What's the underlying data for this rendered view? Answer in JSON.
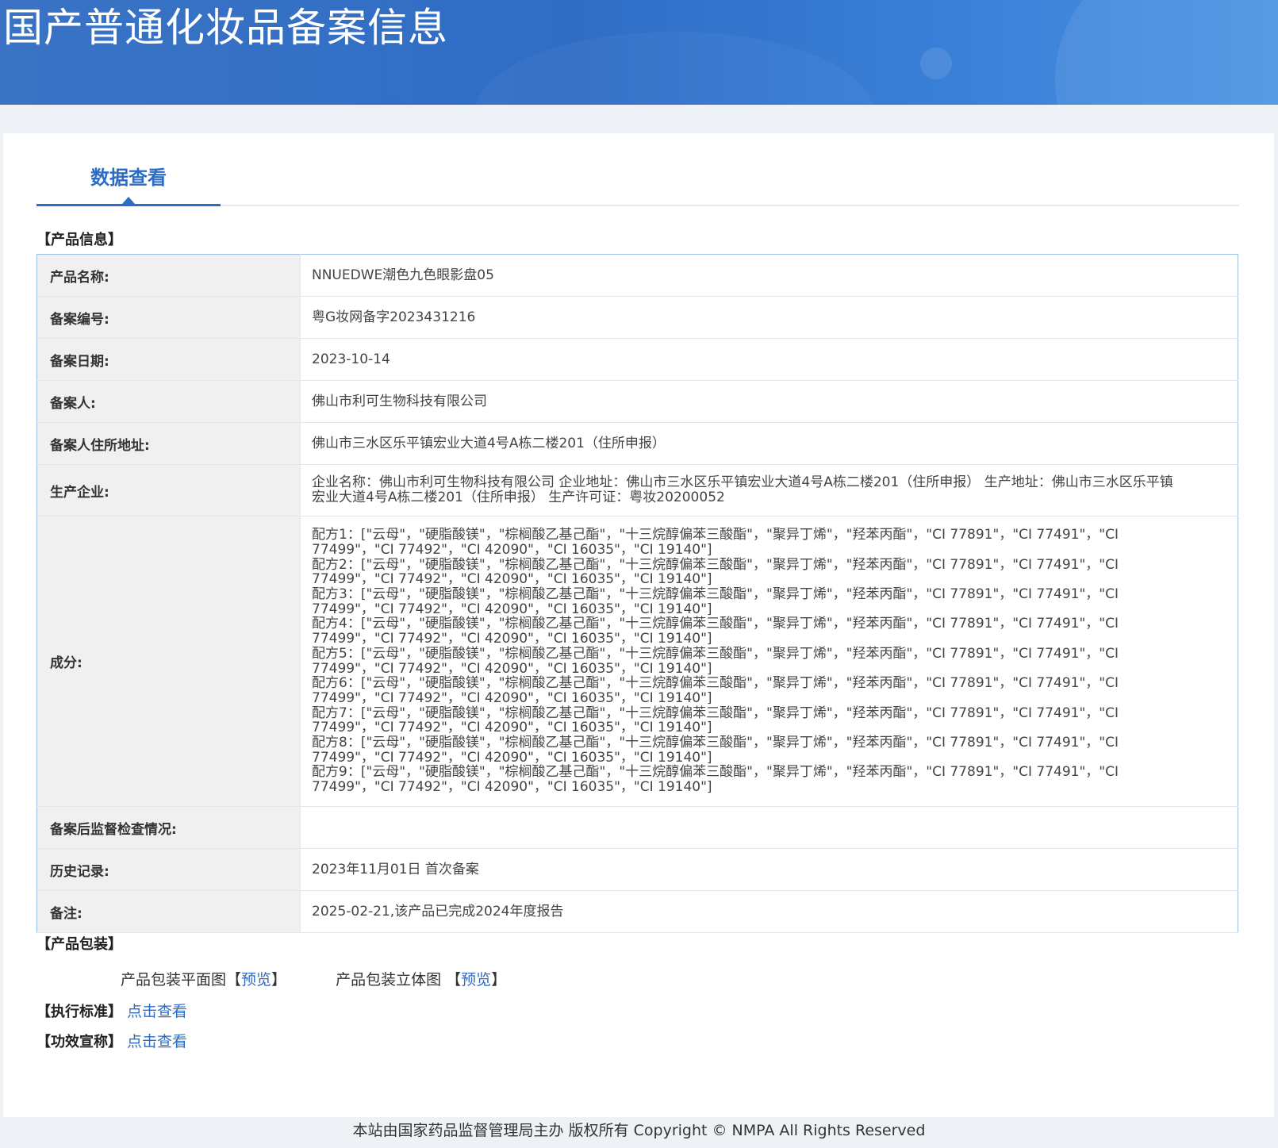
{
  "header": {
    "title": "国产普通化妆品备案信息"
  },
  "tab": {
    "label": "数据查看"
  },
  "sections": {
    "product_info": "【产品信息】",
    "packaging": "【产品包装】"
  },
  "product": {
    "name_label": "产品名称:",
    "name": "NNUEDWE潮色九色眼影盘05",
    "record_no_label": "备案编号:",
    "record_no": "粤G妆网备字2023431216",
    "record_date_label": "备案日期:",
    "record_date": "2023-10-14",
    "registrant_label": "备案人:",
    "registrant": "佛山市利可生物科技有限公司",
    "address_label": "备案人住所地址:",
    "address": "佛山市三水区乐平镇宏业大道4号A栋二楼201（住所申报）",
    "manufacturer_label": "生产企业:",
    "manufacturer": "企业名称：佛山市利可生物科技有限公司 企业地址：佛山市三水区乐平镇宏业大道4号A栋二楼201（住所申报） 生产地址：佛山市三水区乐平镇宏业大道4号A栋二楼201（住所申报） 生产许可证：粤妆20200052",
    "ingredients_label": "成分:",
    "ingredients": [
      "配方1：[\"云母\"，\"硬脂酸镁\"，\"棕榈酸乙基己酯\"，\"十三烷醇偏苯三酸酯\"，\"聚异丁烯\"，\"羟苯丙酯\"，\"CI 77891\"，\"CI 77491\"，\"CI 77499\"，\"CI 77492\"，\"CI 42090\"，\"CI 16035\"，\"CI 19140\"]",
      "配方2：[\"云母\"，\"硬脂酸镁\"，\"棕榈酸乙基己酯\"，\"十三烷醇偏苯三酸酯\"，\"聚异丁烯\"，\"羟苯丙酯\"，\"CI 77891\"，\"CI 77491\"，\"CI 77499\"，\"CI 77492\"，\"CI 42090\"，\"CI 16035\"，\"CI 19140\"]",
      "配方3：[\"云母\"，\"硬脂酸镁\"，\"棕榈酸乙基己酯\"，\"十三烷醇偏苯三酸酯\"，\"聚异丁烯\"，\"羟苯丙酯\"，\"CI 77891\"，\"CI 77491\"，\"CI 77499\"，\"CI 77492\"，\"CI 42090\"，\"CI 16035\"，\"CI 19140\"]",
      "配方4：[\"云母\"，\"硬脂酸镁\"，\"棕榈酸乙基己酯\"，\"十三烷醇偏苯三酸酯\"，\"聚异丁烯\"，\"羟苯丙酯\"，\"CI 77891\"，\"CI 77491\"，\"CI 77499\"，\"CI 77492\"，\"CI 42090\"，\"CI 16035\"，\"CI 19140\"]",
      "配方5：[\"云母\"，\"硬脂酸镁\"，\"棕榈酸乙基己酯\"，\"十三烷醇偏苯三酸酯\"，\"聚异丁烯\"，\"羟苯丙酯\"，\"CI 77891\"，\"CI 77491\"，\"CI 77499\"，\"CI 77492\"，\"CI 42090\"，\"CI 16035\"，\"CI 19140\"]",
      "配方6：[\"云母\"，\"硬脂酸镁\"，\"棕榈酸乙基己酯\"，\"十三烷醇偏苯三酸酯\"，\"聚异丁烯\"，\"羟苯丙酯\"，\"CI 77891\"，\"CI 77491\"，\"CI 77499\"，\"CI 77492\"，\"CI 42090\"，\"CI 16035\"，\"CI 19140\"]",
      "配方7：[\"云母\"，\"硬脂酸镁\"，\"棕榈酸乙基己酯\"，\"十三烷醇偏苯三酸酯\"，\"聚异丁烯\"，\"羟苯丙酯\"，\"CI 77891\"，\"CI 77491\"，\"CI 77499\"，\"CI 77492\"，\"CI 42090\"，\"CI 16035\"，\"CI 19140\"]",
      "配方8：[\"云母\"，\"硬脂酸镁\"，\"棕榈酸乙基己酯\"，\"十三烷醇偏苯三酸酯\"，\"聚异丁烯\"，\"羟苯丙酯\"，\"CI 77891\"，\"CI 77491\"，\"CI 77499\"，\"CI 77492\"，\"CI 42090\"，\"CI 16035\"，\"CI 19140\"]",
      "配方9：[\"云母\"，\"硬脂酸镁\"，\"棕榈酸乙基己酯\"，\"十三烷醇偏苯三酸酯\"，\"聚异丁烯\"，\"羟苯丙酯\"，\"CI 77891\"，\"CI 77491\"，\"CI 77499\"，\"CI 77492\"，\"CI 42090\"，\"CI 16035\"，\"CI 19140\"]"
    ],
    "inspection_label": "备案后监督检查情况:",
    "inspection": "",
    "history_label": "历史记录:",
    "history": "2023年11月01日 首次备案",
    "remark_label": "备注:",
    "remark": "2025-02-21,该产品已完成2024年度报告"
  },
  "packaging": {
    "flat_label": "产品包装平面图",
    "flat_link": "预览",
    "stereo_label": "产品包装立体图",
    "stereo_link": "预览"
  },
  "standard": {
    "label": "【执行标准】",
    "link": "点击查看"
  },
  "efficacy": {
    "label": "【功效宣称】",
    "link": "点击查看"
  },
  "footer": {
    "text": "本站由国家药品监督管理局主办 版权所有 Copyright © NMPA All Rights Reserved"
  },
  "colors": {
    "accent": "#2d6cc4",
    "header_bg": "#3a73c4",
    "label_bg": "#f0f0f0"
  }
}
